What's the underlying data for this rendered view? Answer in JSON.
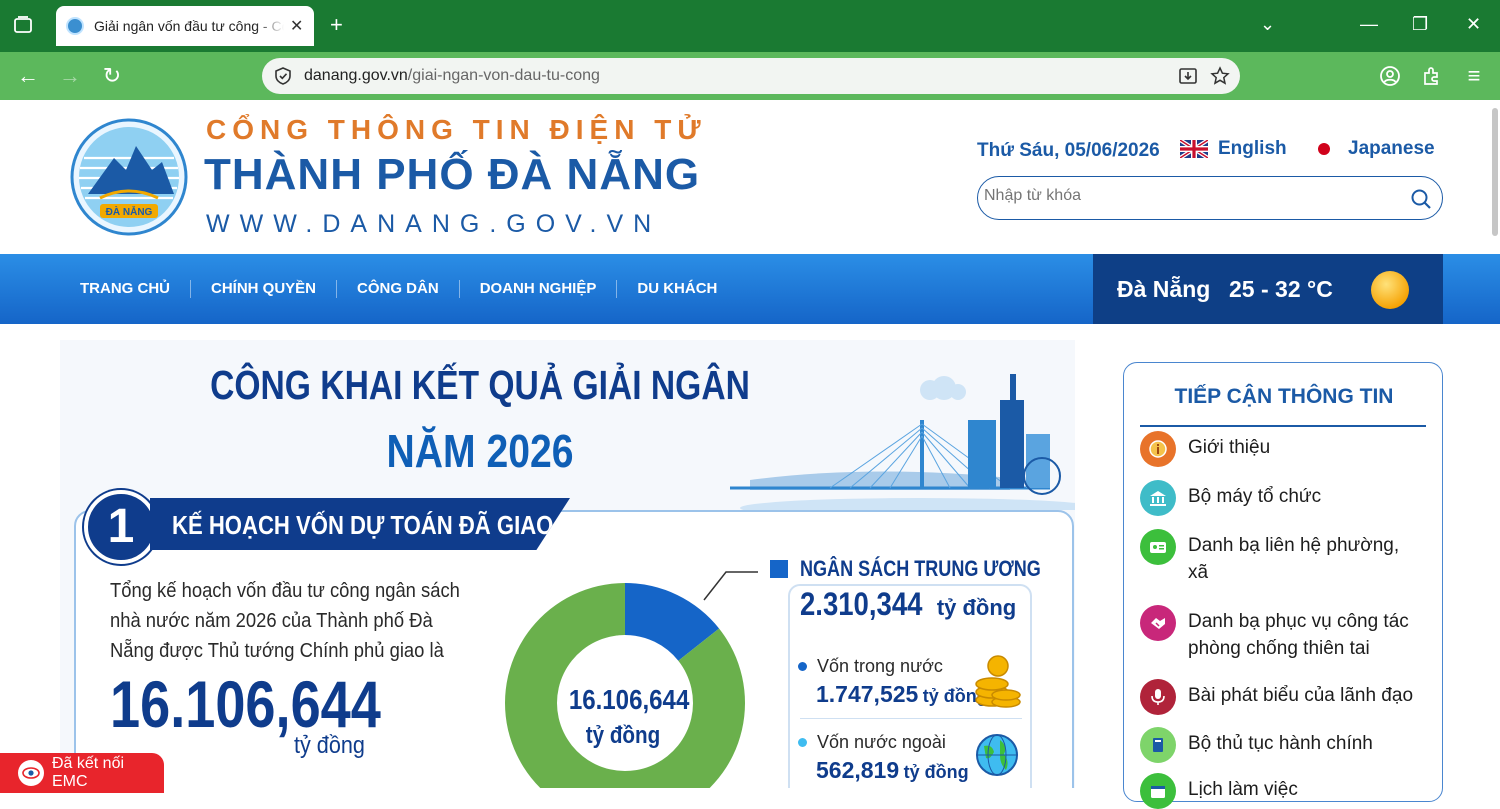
{
  "browser": {
    "tab_title": "Giải ngân vốn đầu tư công - Cổng thông tin điện tử",
    "url_domain": "danang.gov.vn",
    "url_path": "/giai-ngan-von-dau-tu-cong",
    "theme_color": "#1a7a32"
  },
  "header": {
    "brand_line1": "CỔNG THÔNG TIN ĐIỆN TỬ",
    "brand_line2": "THÀNH PHỐ ĐÀ NẴNG",
    "brand_line3": "WWW.DANANG.GOV.VN",
    "logo_text": "ĐÀ NẴNG",
    "date": "Thứ Sáu, 05/06/2026",
    "lang_en": "English",
    "lang_jp": "Japanese",
    "search_placeholder": "Nhập từ khóa"
  },
  "nav": {
    "items": [
      "TRANG CHỦ",
      "CHÍNH QUYỀN",
      "CÔNG DÂN",
      "DOANH NGHIỆP",
      "DU KHÁCH"
    ]
  },
  "weather": {
    "city": "Đà Nẵng",
    "temp": "25 - 32 °C"
  },
  "infographic": {
    "title1": "CÔNG KHAI KẾT QUẢ GIẢI NGÂN",
    "title2": "NĂM 2026",
    "section_number": "1",
    "section_title": "KẾ HOẠCH VỐN DỰ TOÁN ĐÃ GIAO",
    "description": "Tổng kế hoạch vốn đầu tư công ngân sách nhà nước năm 2026 của Thành phố Đà Nẵng được Thủ tướng Chính phủ giao là",
    "total_value": "16.106,644",
    "total_unit": "tỷ đồng",
    "pie_center_value": "16.106,644",
    "pie_center_unit": "tỷ đồng",
    "central_budget_title": "NGÂN SÁCH TRUNG ƯƠNG",
    "central_budget_value": "2.310,344",
    "central_budget_unit": "tỷ đồng",
    "domestic_label": "Vốn trong nước",
    "domestic_value": "1.747,525",
    "domestic_unit": "tỷ đồng",
    "foreign_label": "Vốn nước ngoài",
    "foreign_value": "562,819",
    "foreign_unit": "tỷ đồng",
    "pie_share_central": 0.1434,
    "colors": {
      "central": "#1565c8",
      "local": "#6ab04c"
    }
  },
  "sidebar": {
    "title": "TIẾP CẬN THÔNG TIN",
    "items": [
      {
        "label": "Giới thiệu",
        "icon": "info-icon",
        "color": "#e8732a"
      },
      {
        "label": "Bộ máy tổ chức",
        "icon": "institution-icon",
        "color": "#3fbcc8"
      },
      {
        "label": "Danh bạ liên hệ phường, xã",
        "icon": "contact-card-icon",
        "color": "#3cbf3c"
      },
      {
        "label": "Danh bạ phục vụ công tác phòng chống thiên tai",
        "icon": "handshake-icon",
        "color": "#c8277a"
      },
      {
        "label": "Bài phát biểu của lãnh đạo",
        "icon": "microphone-icon",
        "color": "#b0233a"
      },
      {
        "label": "Bộ thủ tục hành chính",
        "icon": "book-icon",
        "color": "#7ed46a"
      },
      {
        "label": "Lịch làm việc",
        "icon": "calendar-icon",
        "color": "#3cbf3c"
      }
    ]
  },
  "emc_badge": "Đã kết nối EMC"
}
